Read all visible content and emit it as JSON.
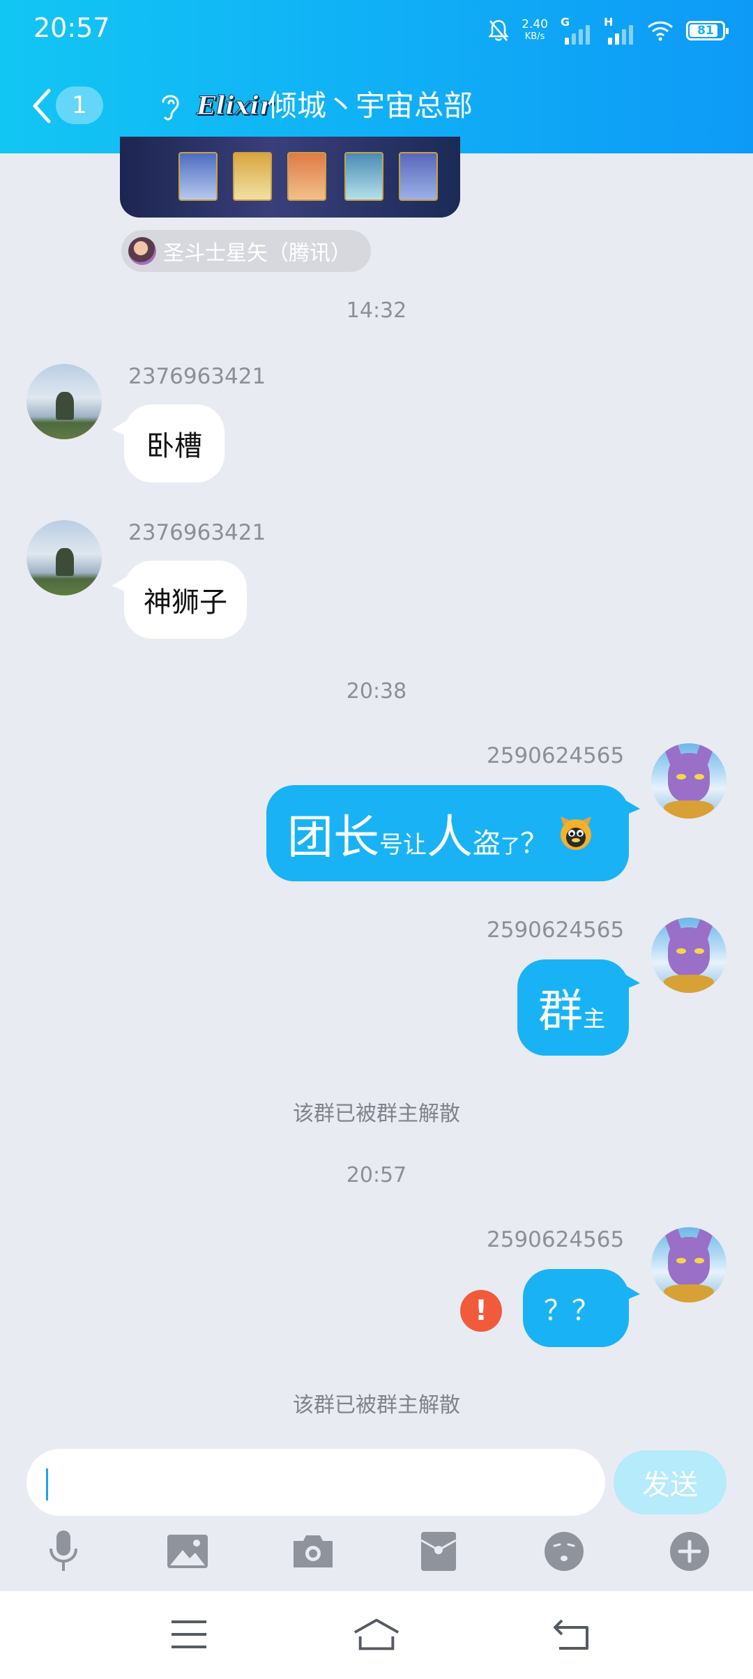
{
  "status_bar": {
    "time": "20:57",
    "net_speed_value": "2.40",
    "net_speed_unit": "KB/s",
    "sim1_type": "G",
    "sim2_type": "H",
    "battery": "81",
    "icons": [
      "bell-off-icon",
      "signal-icon",
      "wifi-icon",
      "battery-icon"
    ]
  },
  "header": {
    "back_icon": "chevron-left-icon",
    "unread_count": "1",
    "ear_icon": "ear-icon",
    "logo_text": "Elixir",
    "group_name": "倾城丶宇宙总部"
  },
  "shared_card": {
    "source_label": "圣斗士星矢（腾讯）"
  },
  "messages": [
    {
      "type": "timestamp",
      "text": "14:32"
    },
    {
      "type": "incoming",
      "sender": "2376963421",
      "text": "卧槽"
    },
    {
      "type": "incoming",
      "sender": "2376963421",
      "text": "神狮子"
    },
    {
      "type": "timestamp",
      "text": "20:38"
    },
    {
      "type": "outgoing",
      "sender": "2590624565",
      "parts": [
        "团长",
        "号让",
        "人",
        "盗",
        "了",
        "？"
      ],
      "emoji": "penguin-emoji"
    },
    {
      "type": "outgoing",
      "sender": "2590624565",
      "parts": [
        "群",
        "主"
      ]
    },
    {
      "type": "system",
      "text": "该群已被群主解散"
    },
    {
      "type": "timestamp",
      "text": "20:57"
    },
    {
      "type": "outgoing",
      "sender": "2590624565",
      "text": "？？",
      "failed": true
    },
    {
      "type": "system",
      "text": "该群已被群主解散"
    }
  ],
  "input": {
    "value": "",
    "send_label": "发送"
  },
  "toolbar": [
    "microphone-icon",
    "image-icon",
    "camera-icon",
    "red-packet-icon",
    "emoji-icon",
    "plus-icon"
  ],
  "nav": [
    "menu-icon",
    "home-icon",
    "back-icon"
  ],
  "colors": {
    "header_start": "#12c6f4",
    "header_end": "#0d9af7",
    "bubble_out": "#19b3f5",
    "send_disabled": "#b5ebfb",
    "error": "#f25a3c",
    "background": "#e9ebf2"
  }
}
